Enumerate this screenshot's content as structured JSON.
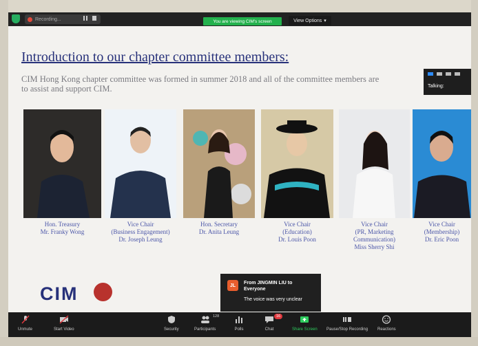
{
  "zoom": {
    "recording_label": "Recording...",
    "viewing_banner": "You are viewing CIM's screen",
    "view_options_label": "View Options",
    "talking_label": "Talking:"
  },
  "slide": {
    "title": "Introduction to our chapter committee members:",
    "intro_line1": "CIM Hong Kong chapter committee was formed in summer 2018 and all of the committee members are",
    "intro_line2": "to assist and support CIM.",
    "logo_text": "CIM",
    "members": [
      {
        "role": "Hon. Treasury",
        "sub": "",
        "name": "Mr. Franky Wong"
      },
      {
        "role": "Vice Chair",
        "sub": "(Business Engagement)",
        "name": "Dr. Joseph Leung"
      },
      {
        "role": "Hon. Secretary",
        "sub": "",
        "name": "Dr. Anita Leung"
      },
      {
        "role": "Vice Chair",
        "sub": "(Education)",
        "name": "Dr. Louis Poon"
      },
      {
        "role": "Vice Chair",
        "sub": "(PR, Marketing Communication)",
        "name": "Miss Sherry Shi"
      },
      {
        "role": "Vice Chair",
        "sub": "(Membership)",
        "name": "Dr. Eric Poon"
      }
    ]
  },
  "chat": {
    "avatar": "JL",
    "from": "From JINGMIN LIU to Everyone",
    "message": "The voice was very unclear"
  },
  "toolbar": {
    "unmute": "Unmute",
    "start_video": "Start Video",
    "security": "Security",
    "participants": "Participants",
    "participants_count": "128",
    "polls": "Polls",
    "chat": "Chat",
    "chat_badge": "16",
    "share_screen": "Share Screen",
    "pause_recording": "Pause/Stop Recording",
    "reactions": "Reactions"
  },
  "colors": {
    "title": "#27317a",
    "caption": "#4b56a8",
    "zoom_green": "#23b14d",
    "toolbar_bg": "#1b1b1b"
  }
}
